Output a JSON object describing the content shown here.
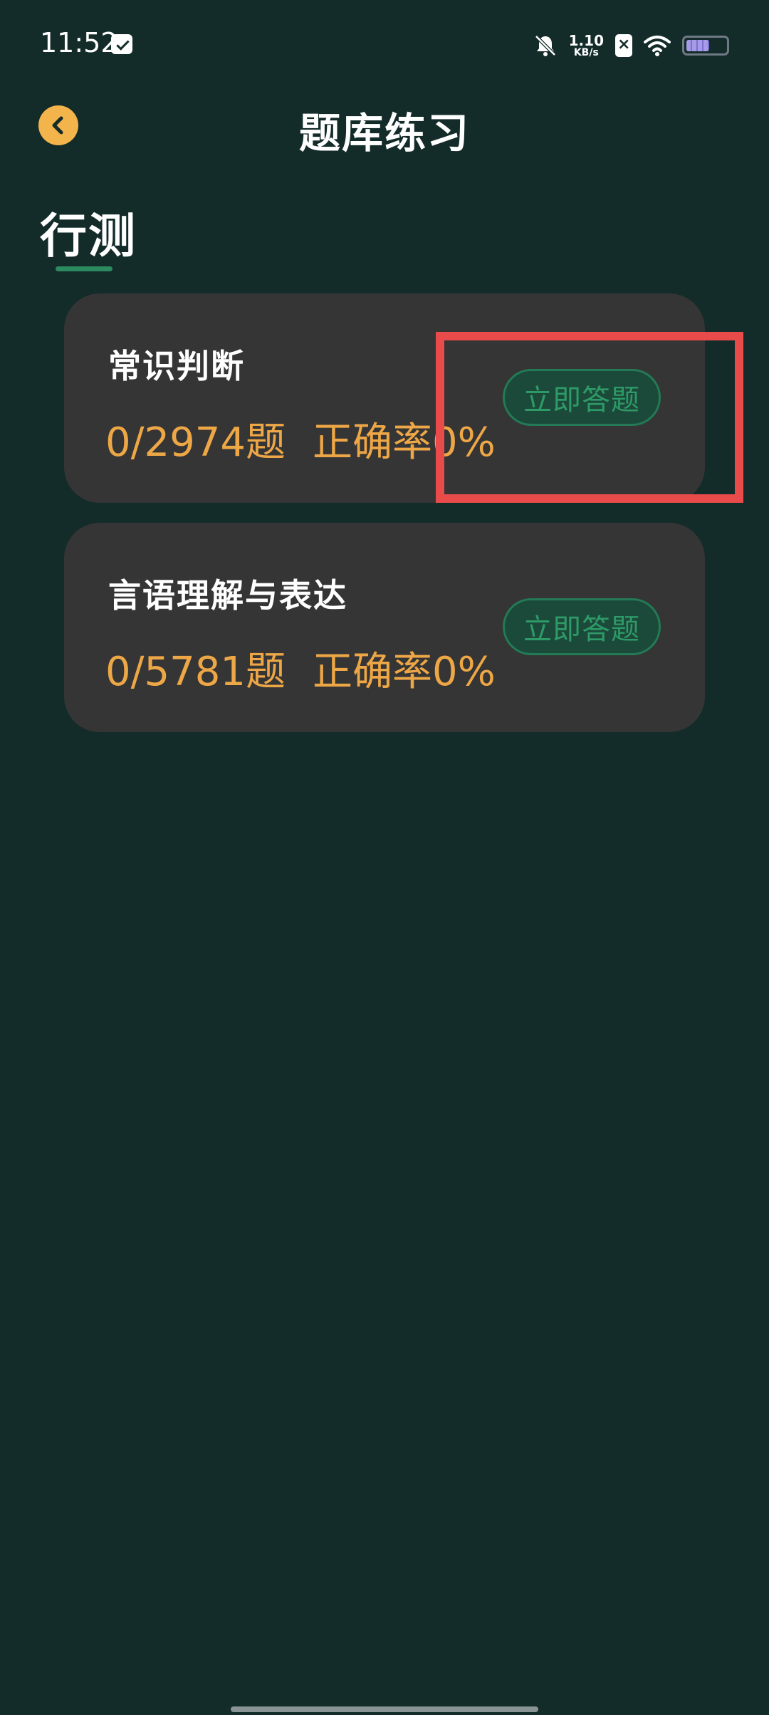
{
  "status_bar": {
    "time": "11:52",
    "net_speed_value": "1.10",
    "net_speed_unit": "KB/s",
    "battery_level": 0.6
  },
  "header": {
    "title": "题库练习",
    "back_icon": "chevron-left-icon"
  },
  "section": {
    "title": "行测"
  },
  "cards": [
    {
      "title": "常识判断",
      "progress": "0/2974题",
      "accuracy": "正确率0%",
      "button_label": "立即答题"
    },
    {
      "title": "言语理解与表达",
      "progress": "0/5781题",
      "accuracy": "正确率0%",
      "button_label": "立即答题"
    }
  ],
  "colors": {
    "background": "#132b29",
    "card": "#353535",
    "accent_orange": "#eea746",
    "accent_green": "#2d9a67",
    "highlight_red": "#e94b4b"
  }
}
